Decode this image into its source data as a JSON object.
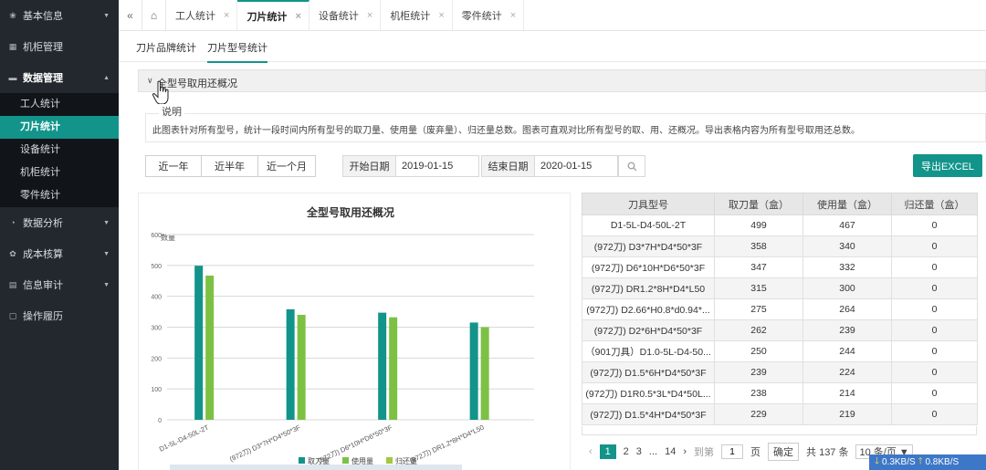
{
  "sidebar": {
    "items": [
      {
        "icon": "info-icon",
        "glyph": "❀",
        "label": "基本信息",
        "arrow": "▼"
      },
      {
        "icon": "cabinet-icon",
        "glyph": "▦",
        "label": "机柜管理",
        "arrow": ""
      },
      {
        "icon": "data-icon",
        "glyph": "▬",
        "label": "数据管理",
        "arrow": "▲"
      },
      {
        "icon": "analysis-icon",
        "glyph": "◔",
        "label": "数据分析",
        "arrow": "▼"
      },
      {
        "icon": "cost-icon",
        "glyph": "✿",
        "label": "成本核算",
        "arrow": "▼"
      },
      {
        "icon": "audit-icon",
        "glyph": "▤",
        "label": "信息审计",
        "arrow": "▼"
      },
      {
        "icon": "history-icon",
        "glyph": "▢",
        "label": "操作履历",
        "arrow": ""
      }
    ],
    "sub_items": [
      "工人统计",
      "刀片统计",
      "设备统计",
      "机柜统计",
      "零件统计"
    ]
  },
  "topbar": {
    "collapse": "«",
    "home": "⌂",
    "tabs": [
      "工人统计",
      "刀片统计",
      "设备统计",
      "机柜统计",
      "零件统计"
    ],
    "close": "×"
  },
  "subtabs": [
    "刀片品牌统计",
    "刀片型号统计"
  ],
  "panel": {
    "title": "全型号取用还概况",
    "desc_legend": "说明",
    "desc_text": "此图表针对所有型号，统计一段时间内所有型号的取刀量、使用量（废弃量）、归还量总数。图表可直观对比所有型号的取、用、还概况。导出表格内容为所有型号取用还总数。"
  },
  "filters": {
    "ranges": [
      "近一年",
      "近半年",
      "近一个月"
    ],
    "start_label": "开始日期",
    "start_value": "2019-01-15",
    "end_label": "结束日期",
    "end_value": "2020-01-15",
    "export": "导出EXCEL"
  },
  "chart_data": {
    "type": "bar",
    "title": "全型号取用还概况",
    "ylabel": "数量",
    "ylim": [
      0,
      600
    ],
    "yticks": [
      "0",
      "100",
      "200",
      "300",
      "400",
      "500",
      "600"
    ],
    "categories": [
      "D1-5L-D4-50L-2T",
      "(972刀) D3*7H*D4*50*3F",
      "(972刀) D6*10H*D6*50*3F",
      "(972刀) DR1.2*8H*D4*L50"
    ],
    "series": [
      {
        "name": "取刀量",
        "color": "#12948a",
        "values": [
          499,
          358,
          347,
          315
        ]
      },
      {
        "name": "使用量",
        "color": "#7cc144",
        "values": [
          467,
          340,
          332,
          300
        ]
      },
      {
        "name": "归还量",
        "color": "#a3c73f",
        "values": [
          0,
          0,
          0,
          0
        ]
      }
    ]
  },
  "table": {
    "headers": [
      "刀具型号",
      "取刀量（盒）",
      "使用量（盒）",
      "归还量（盒）"
    ],
    "rows": [
      [
        "D1-5L-D4-50L-2T",
        "499",
        "467",
        "0"
      ],
      [
        "(972刀) D3*7H*D4*50*3F",
        "358",
        "340",
        "0"
      ],
      [
        "(972刀) D6*10H*D6*50*3F",
        "347",
        "332",
        "0"
      ],
      [
        "(972刀) DR1.2*8H*D4*L50",
        "315",
        "300",
        "0"
      ],
      [
        "(972刀) D2.66*H0.8*d0.94*...",
        "275",
        "264",
        "0"
      ],
      [
        "(972刀) D2*6H*D4*50*3F",
        "262",
        "239",
        "0"
      ],
      [
        "（901刀具）D1.0-5L-D4-50...",
        "250",
        "244",
        "0"
      ],
      [
        "(972刀) D1.5*6H*D4*50*3F",
        "239",
        "224",
        "0"
      ],
      [
        "(972刀) D1R0.5*3L*D4*50L...",
        "238",
        "214",
        "0"
      ],
      [
        "(972刀) D1.5*4H*D4*50*3F",
        "229",
        "219",
        "0"
      ]
    ]
  },
  "pager": {
    "prev": "‹",
    "current": "1",
    "pages": [
      "2",
      "3"
    ],
    "ellipsis": "...",
    "last": "14",
    "next": "›",
    "goto": "到第",
    "goto_value": "1",
    "page_unit": "页",
    "confirm": "确定",
    "total": "共 137 条",
    "size": "10 条/页 ▼"
  },
  "netbar": {
    "down": "0.3KB/S",
    "up": "0.8KB/S"
  }
}
